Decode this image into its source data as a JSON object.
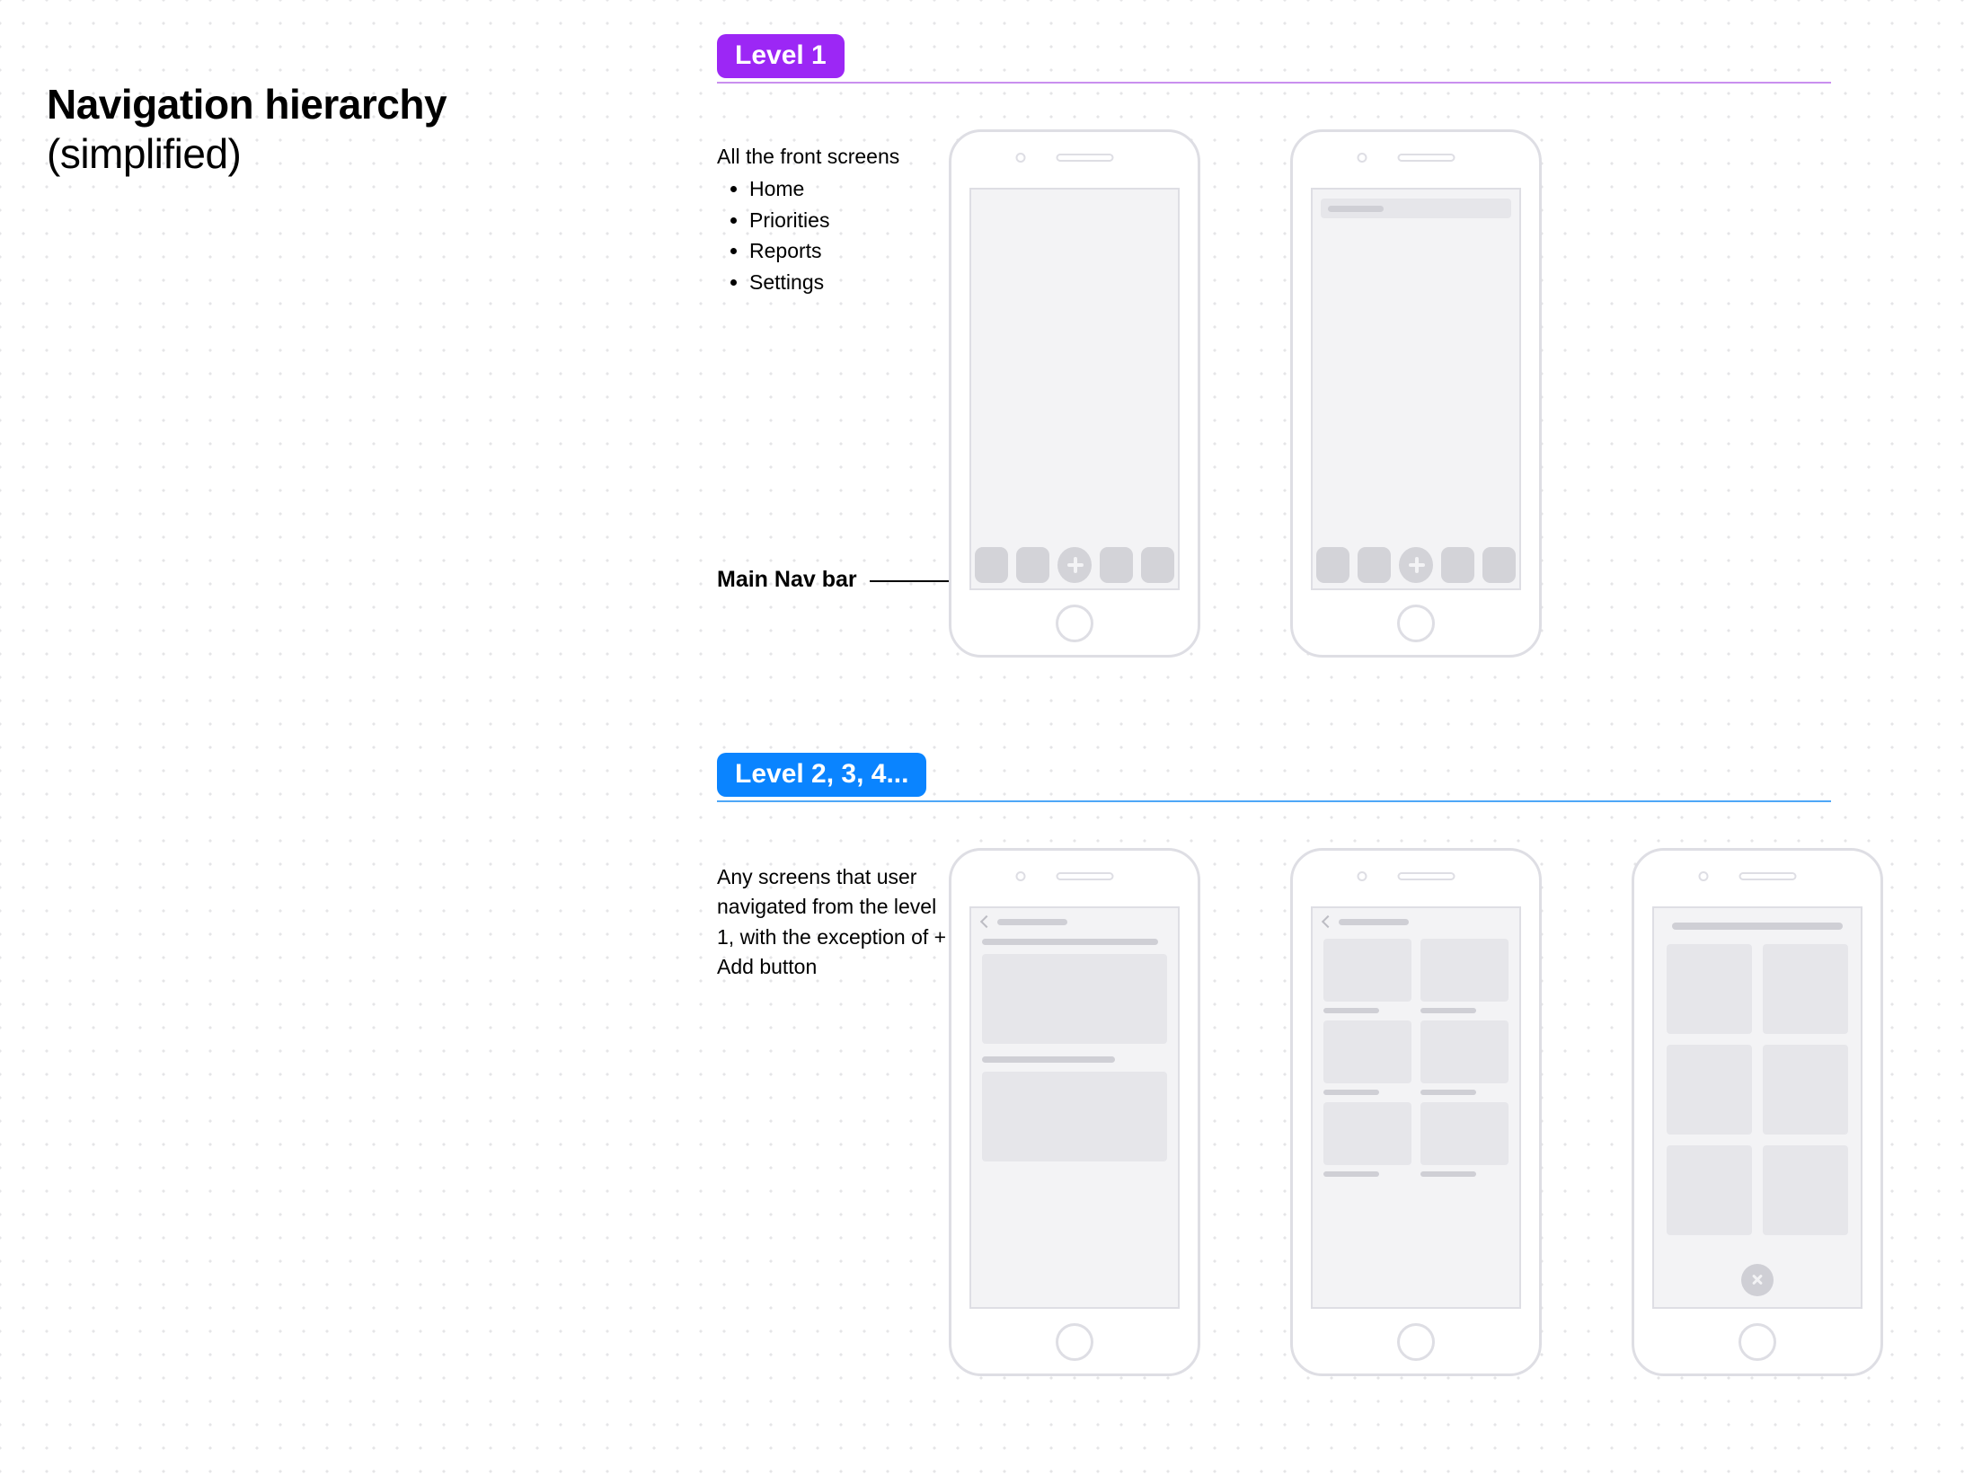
{
  "title": {
    "main": "Navigation hierarchy",
    "sub": "(simplified)"
  },
  "level1": {
    "pill_label": "Level 1",
    "pill_bg": "#9C27F5",
    "underline_color": "#C98FEF",
    "desc_intro": "All the front screens",
    "list": [
      "Home",
      "Priorities",
      "Reports",
      "Settings"
    ],
    "navbar_label": "Main Nav bar"
  },
  "level2": {
    "pill_label": "Level 2, 3, 4...",
    "pill_bg": "#0A84FF",
    "underline_color": "#4EA7F7",
    "desc": "Any screens that user navigated from the level 1, with the exception of + Add button"
  }
}
